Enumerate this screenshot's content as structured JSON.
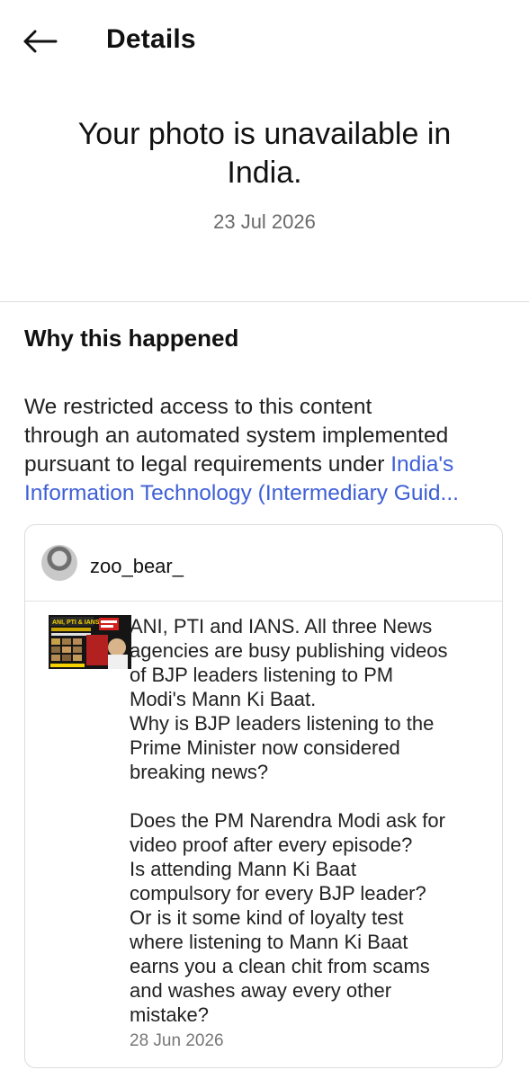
{
  "header": {
    "title": "Details"
  },
  "notice": {
    "title_lines": [
      "Your photo is unavailable in",
      "India."
    ],
    "date": "23 Jul 2026"
  },
  "why": {
    "heading": "Why this happened",
    "body_lines": [
      "We restricted access to this content",
      "through an automated system implemented",
      "pursuant to legal requirements under "
    ],
    "link_part1": "India's",
    "link_part2": "Information Technology (Intermediary Guid..."
  },
  "post": {
    "username": "zoo_bear_",
    "thumbnail_text": "ANI, PTI & IANS",
    "text_lines": [
      "ANI, PTI and IANS. All three News",
      "agencies are busy publishing videos",
      "of BJP leaders listening to PM",
      "Modi's Mann Ki Baat.",
      "Why is BJP leaders listening to the",
      "Prime Minister now considered",
      "breaking news?",
      "",
      "Does the PM Narendra Modi ask for",
      "video proof after every episode?",
      "Is attending Mann Ki Baat",
      "compulsory for every BJP leader?",
      "Or is it some kind of loyalty test",
      "where listening to Mann Ki Baat",
      "earns you a clean chit from scams",
      "and washes away every other",
      "mistake?"
    ],
    "date": "28 Jun 2026"
  },
  "colors": {
    "link": "#3d5fd6",
    "muted": "#6a6a6a",
    "divider": "#dcdcdc"
  },
  "icons": {
    "back": "arrow-left-icon"
  }
}
